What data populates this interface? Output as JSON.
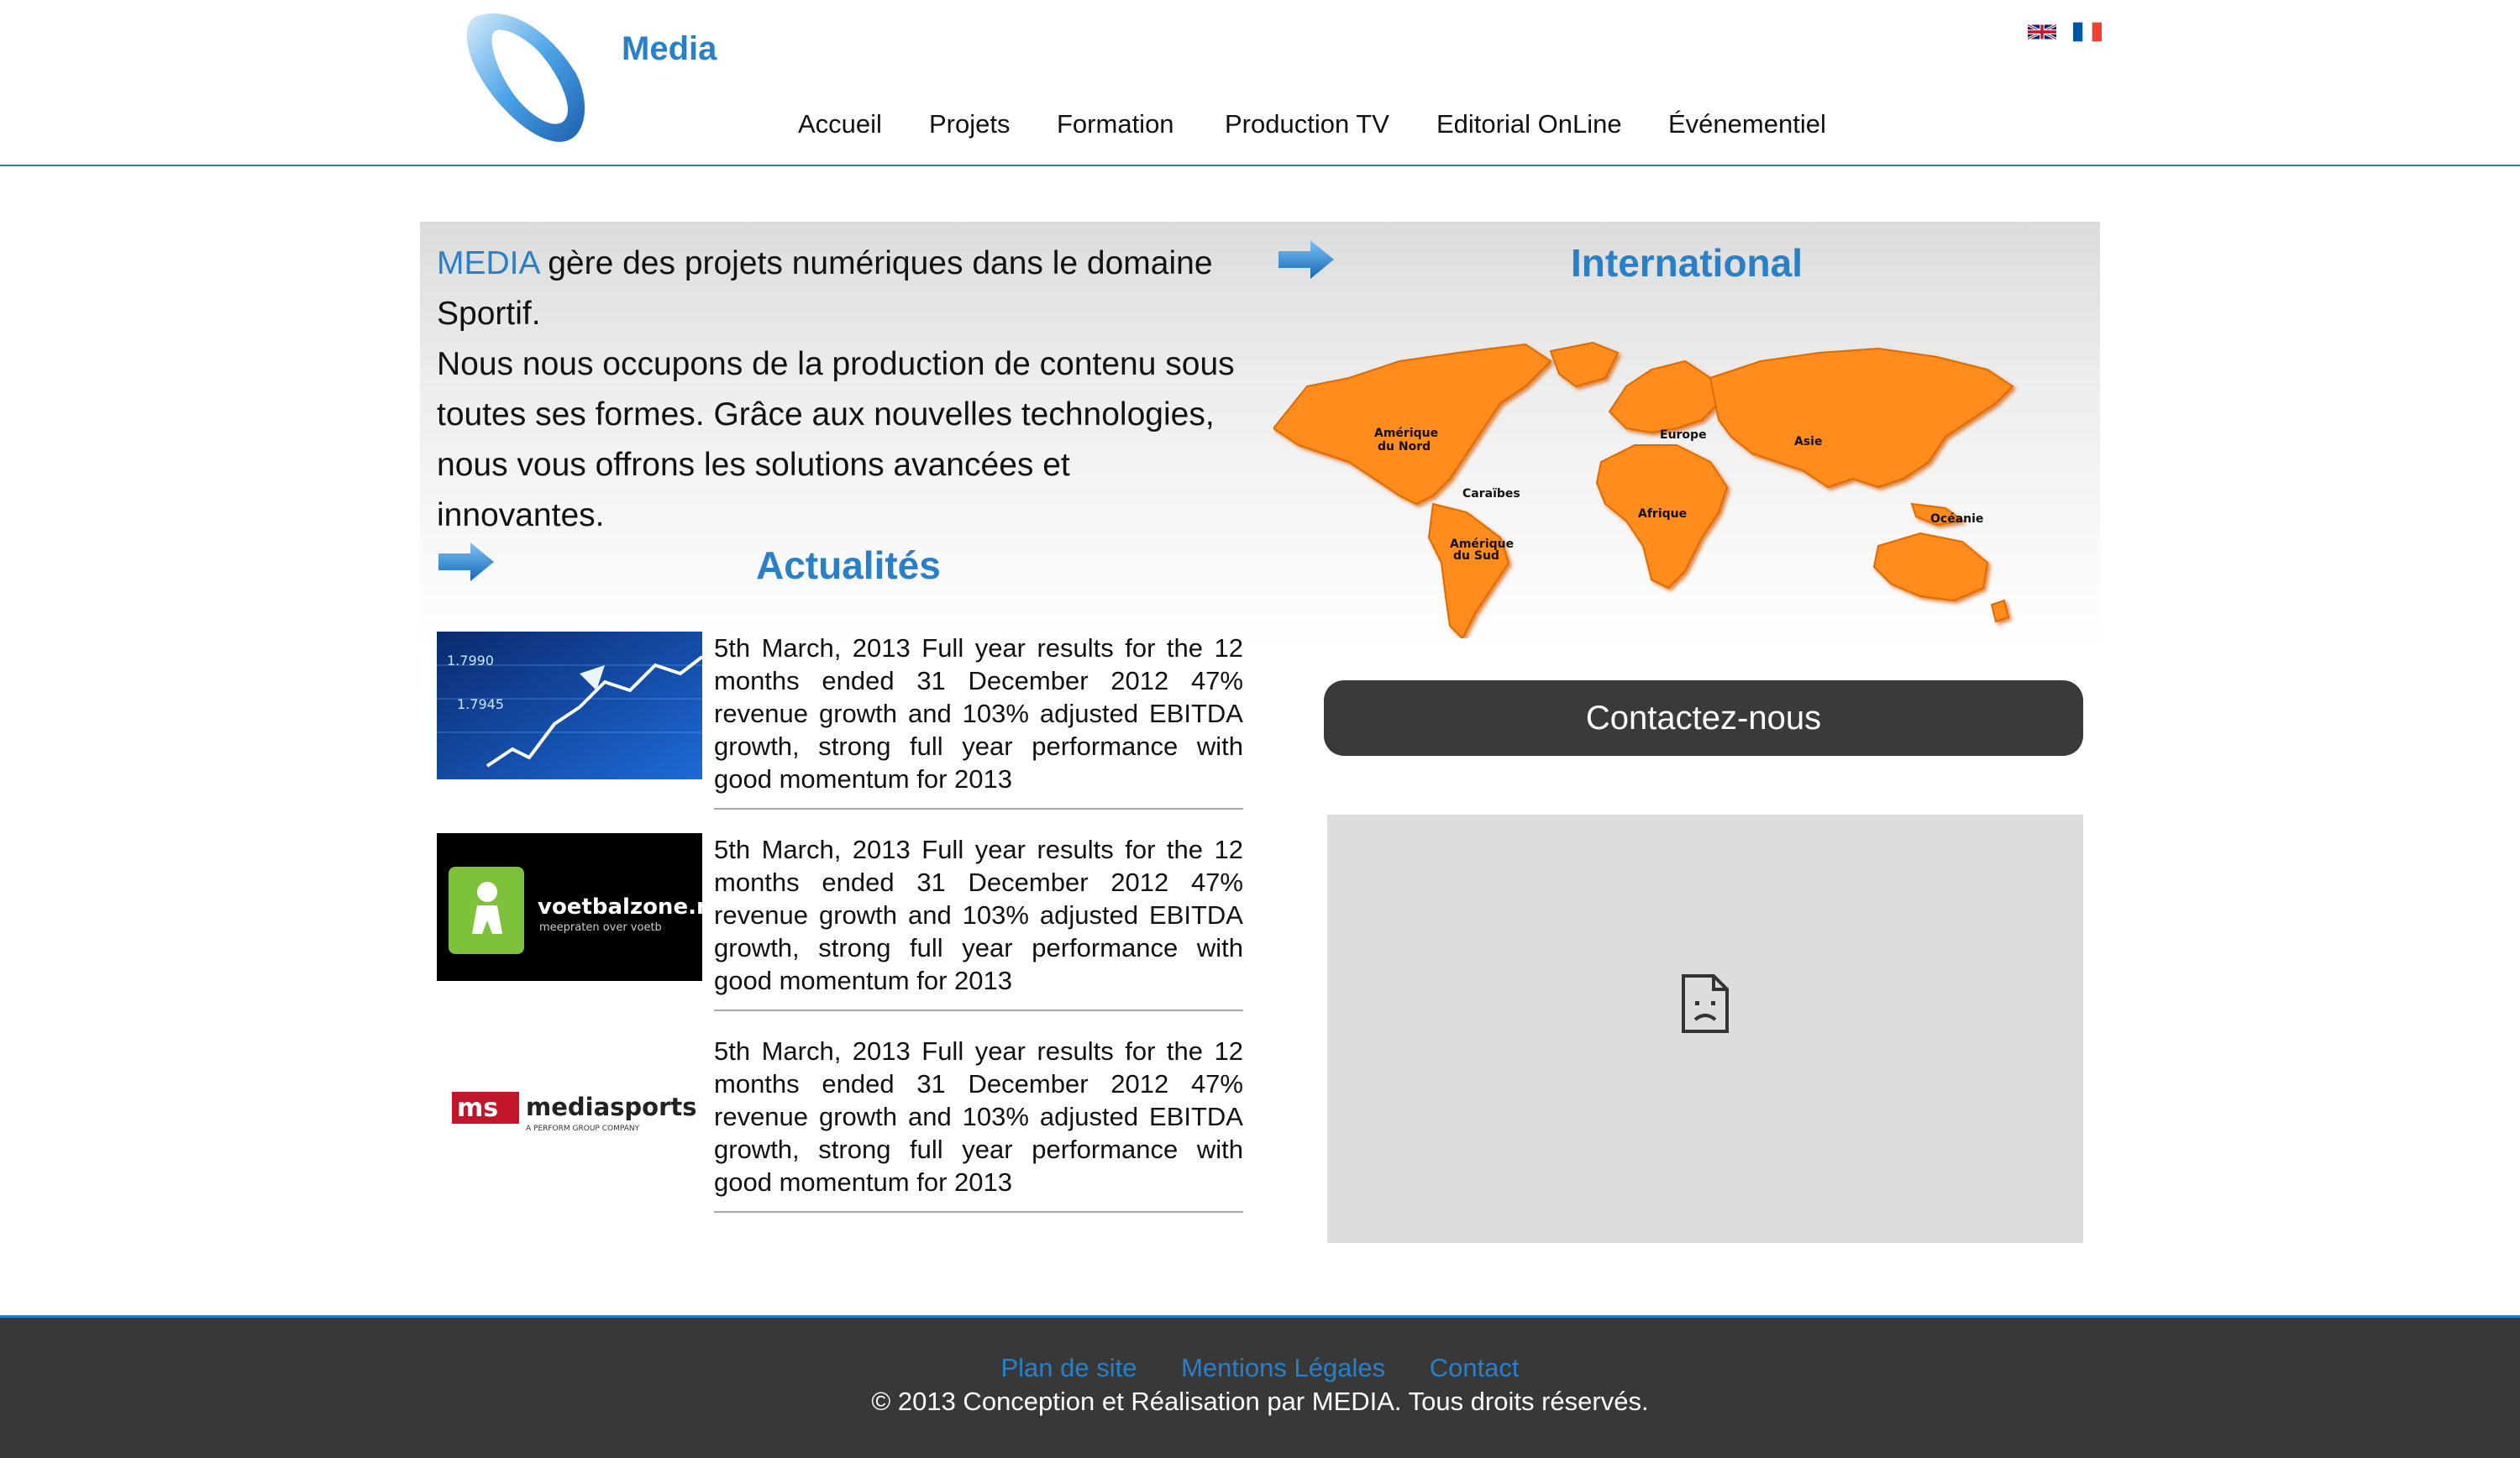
{
  "header": {
    "brand": "Media",
    "nav": [
      "Accueil",
      "Projets",
      "Formation",
      "Production TV",
      "Editorial OnLine",
      "Événementiel"
    ]
  },
  "intro": {
    "accent": "MEDIA",
    "line1": " gère des projets numériques dans le domaine Sportif.",
    "line2": "Nous nous occupons de la production de contenu sous toutes ses formes. Grâce aux nouvelles technologies, nous vous offrons les solutions avancées et innovantes."
  },
  "international": {
    "title": "International",
    "regions": [
      "Amérique",
      "du Nord",
      "Caraïbes",
      "Amérique",
      "du Sud",
      "Europe",
      "Afrique",
      "Asie",
      "Océanie"
    ]
  },
  "news": {
    "title": "Actualités",
    "items": [
      {
        "text": "5th March, 2013 Full year results for the 12 months ended 31 December 2012 47% revenue growth and 103% adjusted EBITDA growth, strong full year performance with good momentum for 2013",
        "thumb_lines": [
          "1.7990",
          "1.7945"
        ]
      },
      {
        "text": "5th March, 2013 Full year results for the 12 months ended 31 December 2012 47% revenue growth and 103% adjusted EBITDA growth, strong full year performance with good momentum for 2013",
        "thumb_lines": [
          "voetbalzone.r",
          "meepraten over voetb"
        ]
      },
      {
        "text": "5th March, 2013 Full year results for the 12 months ended 31 December 2012 47% revenue growth and 103% adjusted EBITDA growth, strong full year performance with good momentum for 2013",
        "thumb_lines": [
          "ms",
          "mediasports",
          "A PERFORM GROUP COMPANY"
        ]
      }
    ]
  },
  "contact": {
    "label": "Contactez-nous"
  },
  "footer": {
    "links": [
      "Plan de site",
      "Mentions Légales",
      "Contact"
    ],
    "copyright": "© 2013 Conception et Réalisation par MEDIA. Tous droits réservés."
  },
  "colors": {
    "accent": "#2a7fc9",
    "map_fill": "#ff8c1a",
    "footer_bg": "#383838",
    "button_bg": "#3a3a3a"
  }
}
